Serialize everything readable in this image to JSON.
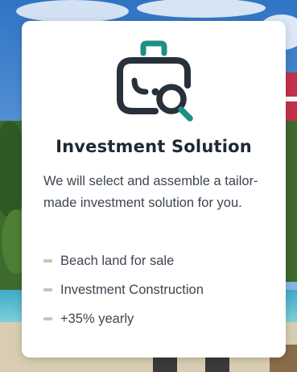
{
  "card": {
    "icon": "briefcase-search-icon",
    "title": "Investment Solution",
    "description": "We will select and assemble a tailor-made investment solution for you.",
    "features": [
      {
        "label": "Beach land for sale"
      },
      {
        "label": "Investment Construction"
      },
      {
        "label": "+35% yearly"
      }
    ]
  },
  "colors": {
    "accent": "#1e8f85",
    "icon_dark": "#27303b",
    "title": "#1f2833",
    "text": "#3d4651",
    "bullet": "#c9c4b5"
  }
}
